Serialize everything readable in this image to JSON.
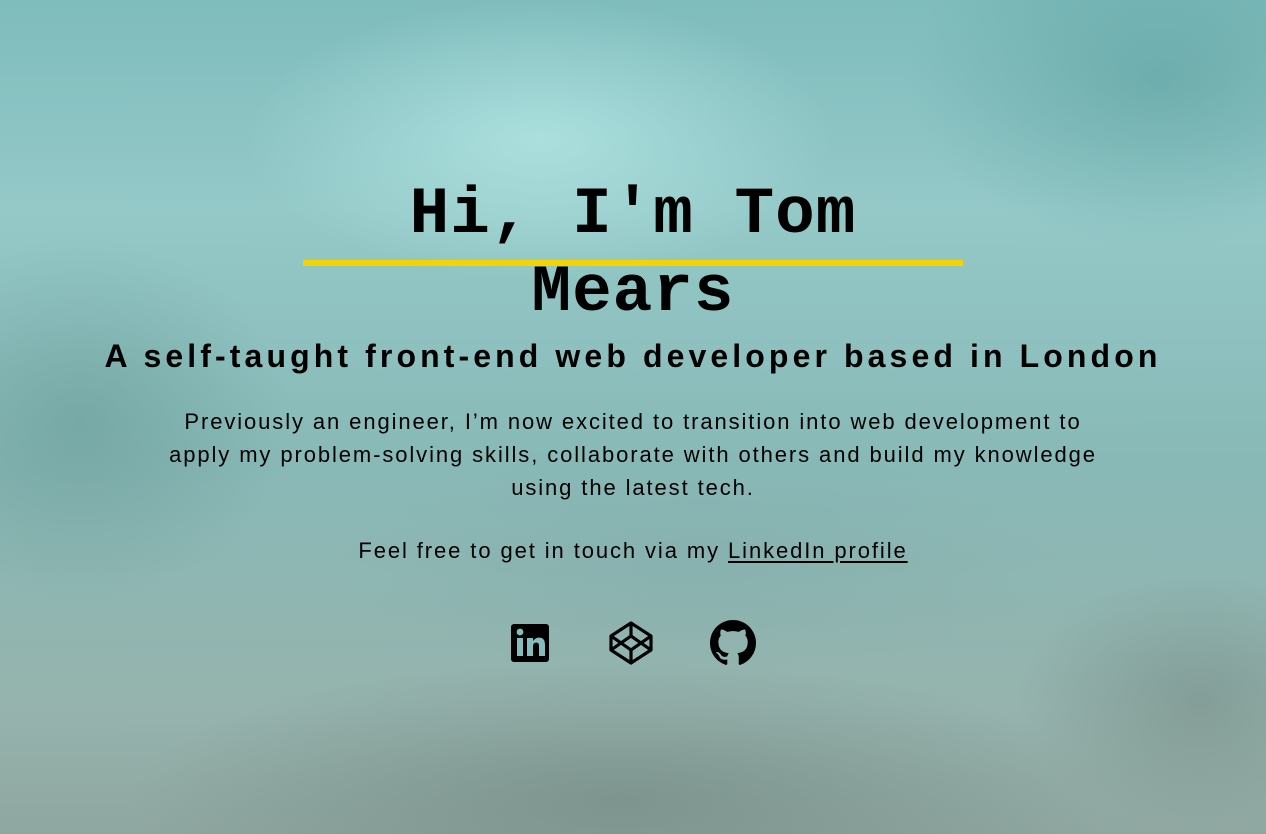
{
  "hero": {
    "title": "Hi, I'm Tom Mears",
    "underline_color": "#f4d300",
    "subtitle": "A self-taught front-end web developer based in London",
    "intro": "Previously an engineer, I’m now excited to transition into web development to apply my problem-solving skills, collaborate with others and build my knowledge using the latest tech.",
    "contact_prefix": "Feel free to get in touch via my ",
    "contact_link": "LinkedIn profile"
  },
  "social": [
    {
      "name": "linkedin",
      "icon": "linkedin-icon"
    },
    {
      "name": "codepen",
      "icon": "codepen-icon"
    },
    {
      "name": "github",
      "icon": "github-icon"
    }
  ]
}
